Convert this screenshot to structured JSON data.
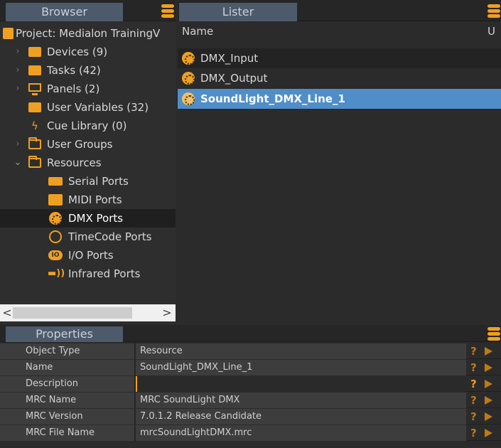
{
  "browser": {
    "tab_label": "Browser",
    "project_label": "Project: Medialon TrainingV",
    "items": [
      {
        "label": "Devices (9)",
        "icon": "folder-device-icon"
      },
      {
        "label": "Tasks (42)",
        "icon": "folder-tasks-icon"
      },
      {
        "label": "Panels (2)",
        "icon": "monitor-icon"
      },
      {
        "label": "User Variables (32)",
        "icon": "folder-variables-icon"
      },
      {
        "label": "Cue Library (0)",
        "icon": "lightning-icon"
      },
      {
        "label": "User Groups",
        "icon": "folder-icon"
      },
      {
        "label": "Resources",
        "icon": "folder-open-icon"
      },
      {
        "label": "Serial Ports",
        "icon": "serial-port-icon"
      },
      {
        "label": "MIDI Ports",
        "icon": "midi-port-icon"
      },
      {
        "label": "DMX Ports",
        "icon": "dmx-port-icon"
      },
      {
        "label": "TimeCode Ports",
        "icon": "timecode-icon"
      },
      {
        "label": "I/O Ports",
        "icon": "io-port-icon"
      },
      {
        "label": "Infrared Ports",
        "icon": "infrared-icon"
      }
    ]
  },
  "lister": {
    "tab_label": "Lister",
    "col_name": "Name",
    "col_u": "U",
    "rows": [
      {
        "label": "DMX_Input"
      },
      {
        "label": "DMX_Output"
      },
      {
        "label": "SoundLight_DMX_Line_1"
      }
    ]
  },
  "properties": {
    "tab_label": "Properties",
    "help_glyph": "?",
    "rows": [
      {
        "key": "Object Type",
        "value": "Resource"
      },
      {
        "key": "Name",
        "value": "SoundLight_DMX_Line_1"
      },
      {
        "key": "Description",
        "value": ""
      },
      {
        "key": "MRC Name",
        "value": "MRC SoundLight DMX"
      },
      {
        "key": "MRC Version",
        "value": "7.0.1.2 Release Candidate"
      },
      {
        "key": "MRC File Name",
        "value": "mrcSoundLightDMX.mrc"
      }
    ]
  },
  "scroll": {
    "left": "<",
    "right": ">"
  },
  "colors": {
    "accent": "#f0a020",
    "selection": "#4f8ec9",
    "tab": "#4c5a6c"
  }
}
